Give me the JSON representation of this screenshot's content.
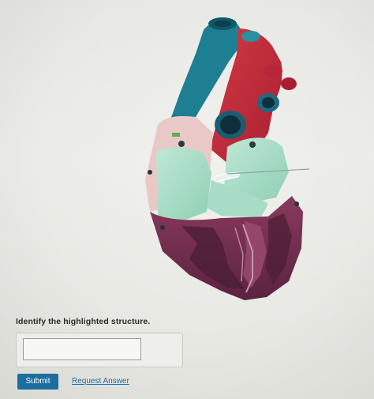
{
  "question": {
    "prompt": "Identify the highlighted structure."
  },
  "answer": {
    "value": "",
    "placeholder": ""
  },
  "actions": {
    "submit_label": "Submit",
    "request_answer_label": "Request Answer"
  },
  "image": {
    "subject": "heart model, sectioned anterior view",
    "highlight_color": "#e9f1ef"
  },
  "colors": {
    "submit_bg": "#1b6e9e",
    "link": "#1f6fa3",
    "aorta_red": "#c8283a",
    "pulmonary_blue": "#1e7f93",
    "myocardium_purple": "#6e2e4c",
    "atrium_mint": "#a9dcc6"
  }
}
